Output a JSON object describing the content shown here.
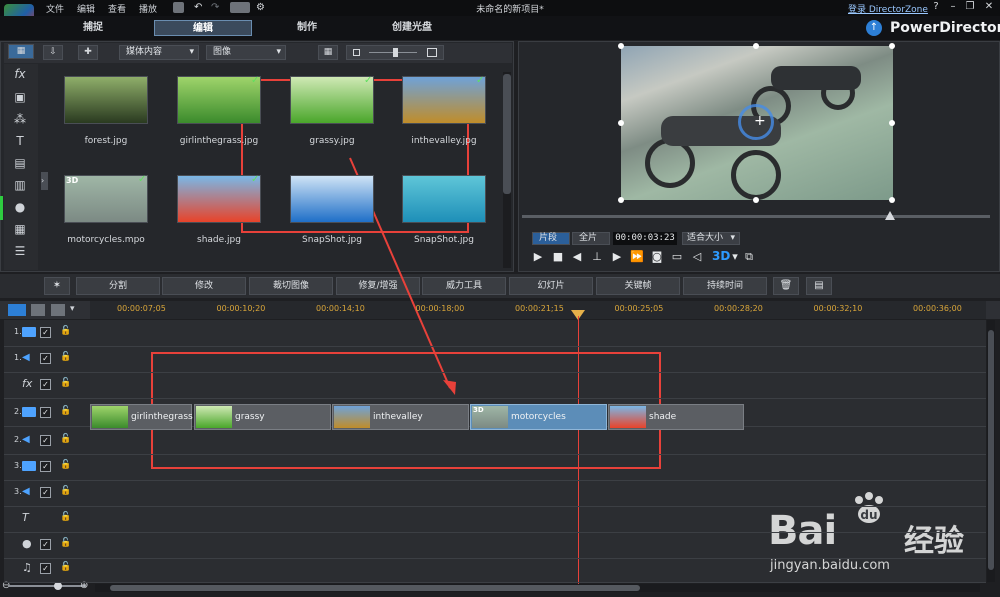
{
  "titlebar": {
    "menus": [
      "文件",
      "编辑",
      "查看",
      "播放"
    ],
    "title": "未命名的新项目*",
    "login": "登录 DirectorZone",
    "help": "?",
    "minimize": "–",
    "restore": "❐",
    "close": "✕"
  },
  "modes": [
    "捕捉",
    "编辑",
    "制作",
    "创建光盘"
  ],
  "brand": "PowerDirector",
  "library": {
    "content_dropdown": "媒体内容",
    "type_dropdown": "图像",
    "items": [
      {
        "name": "forest.jpg",
        "checked": false,
        "is3d": false,
        "colors": [
          "#2a3a20",
          "#8fae6a"
        ]
      },
      {
        "name": "girlinthegrass.jpg",
        "checked": true,
        "is3d": false,
        "colors": [
          "#3b8b2c",
          "#9fd46b"
        ]
      },
      {
        "name": "grassy.jpg",
        "checked": true,
        "is3d": false,
        "colors": [
          "#4aa62a",
          "#cfe9b4"
        ]
      },
      {
        "name": "inthevalley.jpg",
        "checked": true,
        "is3d": false,
        "colors": [
          "#c08d2a",
          "#6fa2d8"
        ]
      },
      {
        "name": "motorcycles.mpo",
        "checked": true,
        "is3d": true,
        "colors": [
          "#7c8a84",
          "#9fb6a6"
        ]
      },
      {
        "name": "shade.jpg",
        "checked": true,
        "is3d": false,
        "colors": [
          "#e8432a",
          "#7ab7e6"
        ]
      },
      {
        "name": "SnapShot.jpg",
        "checked": false,
        "is3d": false,
        "colors": [
          "#1f6fc8",
          "#cfe3f6"
        ]
      },
      {
        "name": "SnapShot.jpg",
        "checked": false,
        "is3d": false,
        "colors": [
          "#1e8fb8",
          "#5fc6d8"
        ]
      }
    ]
  },
  "preview": {
    "segment": "片段",
    "full": "全片",
    "timecode": "00:00:03:23",
    "fit": "适合大小",
    "three_d": "3D"
  },
  "editbar": {
    "buttons": [
      "分割",
      "修改",
      "裁切图像",
      "修复/增强",
      "威力工具",
      "幻灯片",
      "关键帧",
      "持续时间"
    ]
  },
  "timeline": {
    "ruler": [
      "00:00:07;05",
      "00:00:10;20",
      "00:00:14;10",
      "00:00:18;00",
      "00:00:21;15",
      "00:00:25;05",
      "00:00:28;20",
      "00:00:32;10",
      "00:00:36;00"
    ],
    "tracks": [
      {
        "num": "1.",
        "type": "video"
      },
      {
        "num": "1.",
        "type": "audio"
      },
      {
        "num": "",
        "type": "fx"
      },
      {
        "num": "2.",
        "type": "video"
      },
      {
        "num": "2.",
        "type": "audio"
      },
      {
        "num": "3.",
        "type": "video"
      },
      {
        "num": "3.",
        "type": "audio"
      },
      {
        "num": "",
        "type": "title"
      },
      {
        "num": "",
        "type": "voice"
      },
      {
        "num": "",
        "type": "music"
      }
    ],
    "clips": [
      {
        "name": "girlinthegrass",
        "colors": [
          "#3b8b2c",
          "#9fd46b"
        ],
        "selected": false,
        "is3d": false
      },
      {
        "name": "grassy",
        "colors": [
          "#4aa62a",
          "#cfe9b4"
        ],
        "selected": false,
        "is3d": false
      },
      {
        "name": "inthevalley",
        "colors": [
          "#c08d2a",
          "#6fa2d8"
        ],
        "selected": false,
        "is3d": false
      },
      {
        "name": "motorcycles",
        "colors": [
          "#7c8a84",
          "#9fb6a6"
        ],
        "selected": true,
        "is3d": true
      },
      {
        "name": "shade",
        "colors": [
          "#e8432a",
          "#7ab7e6"
        ],
        "selected": false,
        "is3d": false
      }
    ]
  },
  "watermark": {
    "brand_latin": "Bai",
    "brand_cn": "经验",
    "url": "jingyan.baidu.com"
  }
}
